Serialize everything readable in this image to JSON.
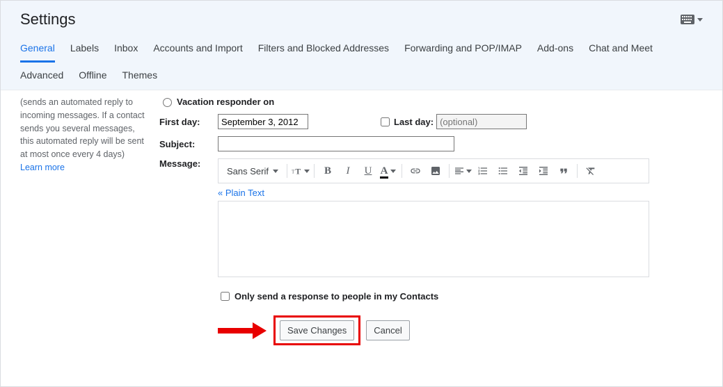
{
  "title": "Settings",
  "tabs": [
    "General",
    "Labels",
    "Inbox",
    "Accounts and Import",
    "Filters and Blocked Addresses",
    "Forwarding and POP/IMAP",
    "Add-ons",
    "Chat and Meet",
    "Advanced",
    "Offline",
    "Themes"
  ],
  "activeTab": "General",
  "help": {
    "text": "(sends an automated reply to incoming messages. If a contact sends you several messages, this automated reply will be sent at most once every 4 days)",
    "learnMore": "Learn more"
  },
  "vacation": {
    "radioOnLabel": "Vacation responder on",
    "firstDayLabel": "First day:",
    "firstDayValue": "September 3, 2012",
    "lastDayLabel": "Last day:",
    "lastDayPlaceholder": "(optional)",
    "subjectLabel": "Subject:",
    "subjectValue": "",
    "messageLabel": "Message:",
    "fontName": "Sans Serif",
    "plainTextLink": "« Plain Text",
    "contactsOnlyLabel": "Only send a response to people in my Contacts"
  },
  "buttons": {
    "save": "Save Changes",
    "cancel": "Cancel"
  }
}
